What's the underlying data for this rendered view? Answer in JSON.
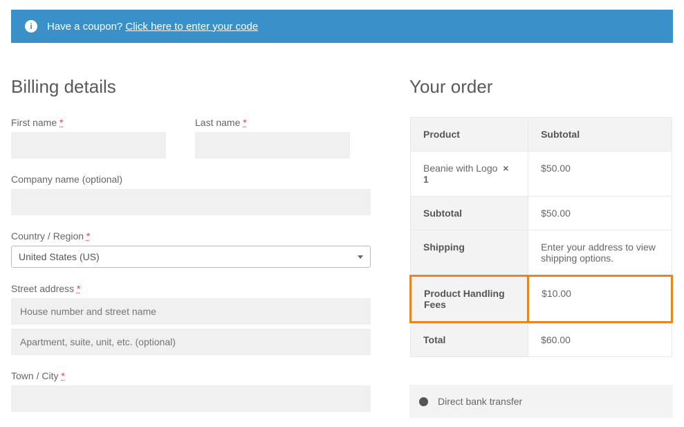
{
  "banner": {
    "text": "Have a coupon?",
    "link": "Click here to enter your code"
  },
  "billing": {
    "heading": "Billing details",
    "first_name_label": "First name",
    "last_name_label": "Last name",
    "company_label": "Company name (optional)",
    "country_label": "Country / Region",
    "country_value": "United States (US)",
    "street_label": "Street address",
    "street_placeholder": "House number and street name",
    "apt_placeholder": "Apartment, suite, unit, etc. (optional)",
    "city_label": "Town / City",
    "required": "*"
  },
  "order": {
    "heading": "Your order",
    "headers": {
      "product": "Product",
      "subtotal": "Subtotal"
    },
    "item": {
      "name": "Beanie with Logo",
      "qty": "× 1"
    },
    "item_price": "$50.00",
    "subtotal_label": "Subtotal",
    "subtotal_value": "$50.00",
    "shipping_label": "Shipping",
    "shipping_value": "Enter your address to view shipping options.",
    "fees_label": "Product Handling Fees",
    "fees_value": "$10.00",
    "total_label": "Total",
    "total_value": "$60.00"
  },
  "payment": {
    "option": "Direct bank transfer"
  }
}
